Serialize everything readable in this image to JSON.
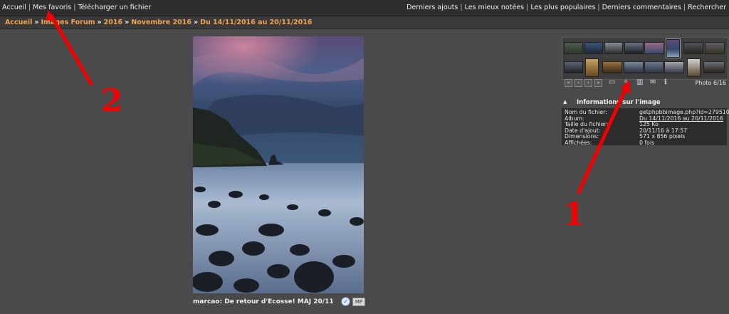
{
  "topnav": {
    "left": [
      "Accueil",
      "Mes favoris",
      "Télécharger un fichier"
    ],
    "right": [
      "Derniers ajouts",
      "Les mieux notées",
      "Les plus populaires",
      "Derniers commentaires",
      "Rechercher"
    ]
  },
  "breadcrumb": [
    "Accueil",
    "Images Forum",
    "2016",
    "Novembre 2016",
    "Du 14/11/2016 au 20/11/2016"
  ],
  "photo": {
    "caption": "marcao: De retour d'Ecosse! MAJ 20/11",
    "badge": "MP"
  },
  "filmstrip": {
    "count_text": "Photo 6/16",
    "nav_buttons": [
      "first",
      "prev",
      "next",
      "last"
    ],
    "tool_icons": [
      "slideshow-icon",
      "ecard-icon",
      "favorite-icon",
      "email-icon",
      "info-icon"
    ]
  },
  "info": {
    "title": "Informations sur l'image",
    "rows": [
      {
        "key": "Nom du fichier:",
        "value": "getphpbbimage.php?id=279510"
      },
      {
        "key": "Album:",
        "value": "Du 14/11/2016 au 20/11/2016"
      },
      {
        "key": "Taille du fichier:",
        "value": "125 Ko"
      },
      {
        "key": "Date d'ajout:",
        "value": "20/11/16 à 17:57"
      },
      {
        "key": "Dimensions:",
        "value": "571 x 856 pixels"
      },
      {
        "key": "Affichées:",
        "value": "0 fois"
      }
    ]
  },
  "annotations": {
    "one": "1",
    "two": "2"
  },
  "colors": {
    "accent": "#f1a24f",
    "annotation": "#f20000",
    "background": "#4a4a4a"
  }
}
